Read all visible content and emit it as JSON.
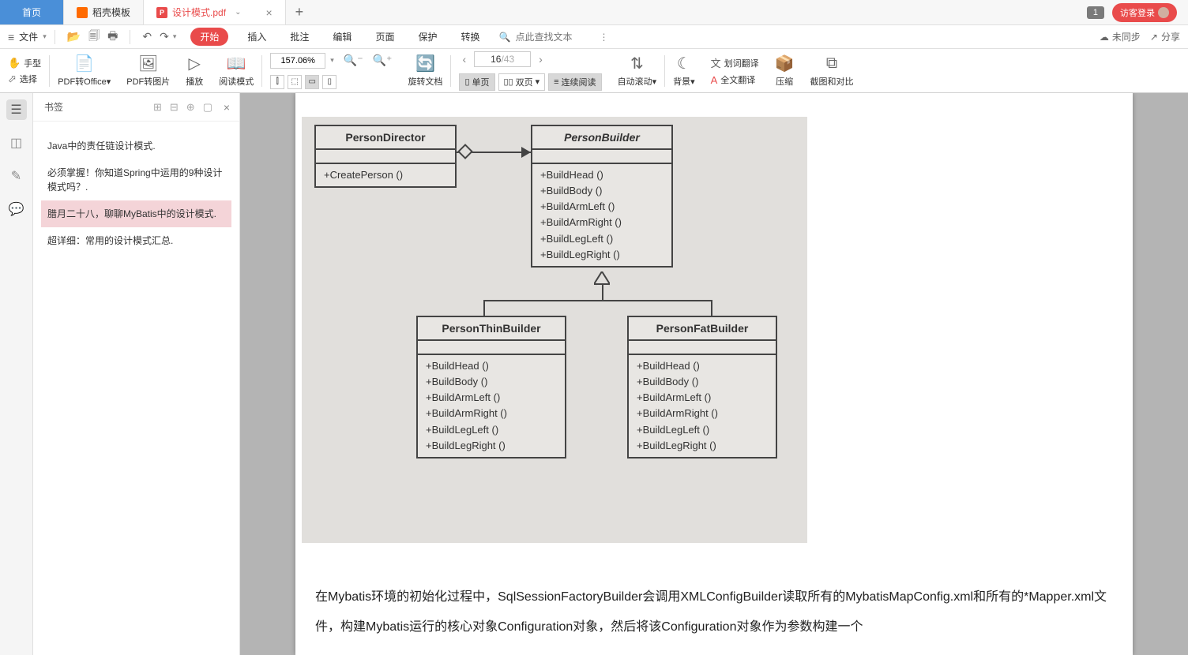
{
  "tabs": {
    "home": "首页",
    "docshell": "稻壳模板",
    "active": "设计模式.pdf",
    "badge": "1",
    "login": "访客登录"
  },
  "menubar": {
    "file": "文件",
    "items": [
      "开始",
      "插入",
      "批注",
      "编辑",
      "页面",
      "保护",
      "转换"
    ],
    "search_placeholder": "点此查找文本",
    "unsync": "未同步",
    "share": "分享"
  },
  "toolbar": {
    "hand": "手型",
    "select": "选择",
    "pdf2office": "PDF转Office",
    "pdf2img": "PDF转图片",
    "play": "播放",
    "readmode": "阅读模式",
    "zoom": "157.06%",
    "rotate": "旋转文档",
    "page_current": "16",
    "page_total": "/43",
    "single": "单页",
    "double": "双页",
    "cont": "连续阅读",
    "autoscroll": "自动滚动",
    "bg": "背景",
    "wordtrans": "划词翻译",
    "fulltrans": "全文翻译",
    "compress": "压缩",
    "crop": "截图和对比"
  },
  "bookmarks": {
    "title": "书签",
    "items": [
      "Java中的责任链设计模式.",
      "必须掌握！你知道Spring中运用的9种设计模式吗？.",
      "腊月二十八，聊聊MyBatis中的设计模式.",
      "超详细：常用的设计模式汇总."
    ],
    "activeIndex": 2
  },
  "uml": {
    "director": {
      "name": "PersonDirector",
      "methods": [
        "+CreatePerson ()"
      ]
    },
    "builder": {
      "name": "PersonBuilder",
      "methods": [
        "+BuildHead ()",
        "+BuildBody ()",
        "+BuildArmLeft ()",
        "+BuildArmRight ()",
        "+BuildLegLeft ()",
        "+BuildLegRight ()"
      ]
    },
    "thin": {
      "name": "PersonThinBuilder",
      "methods": [
        "+BuildHead ()",
        "+BuildBody ()",
        "+BuildArmLeft ()",
        "+BuildArmRight ()",
        "+BuildLegLeft ()",
        "+BuildLegRight ()"
      ]
    },
    "fat": {
      "name": "PersonFatBuilder",
      "methods": [
        "+BuildHead ()",
        "+BuildBody ()",
        "+BuildArmLeft ()",
        "+BuildArmRight ()",
        "+BuildLegLeft ()",
        "+BuildLegRight ()"
      ]
    }
  },
  "doc_text": "在Mybatis环境的初始化过程中，SqlSessionFactoryBuilder会调用XMLConfigBuilder读取所有的MybatisMapConfig.xml和所有的*Mapper.xml文件，构建Mybatis运行的核心对象Configuration对象，然后将该Configuration对象作为参数构建一个"
}
